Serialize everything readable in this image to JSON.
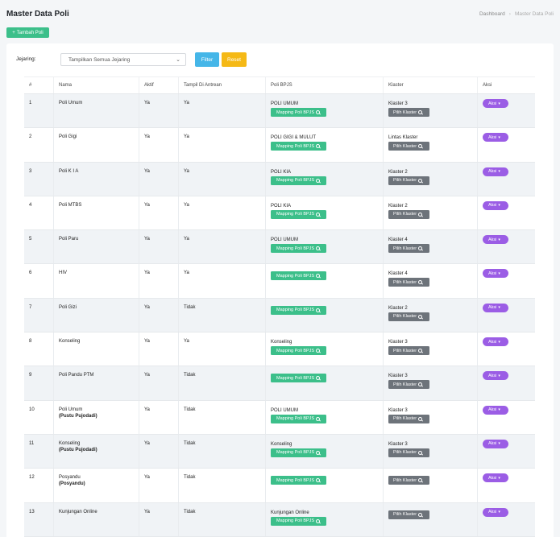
{
  "header": {
    "title": "Master Data Poli",
    "breadcrumb": [
      "Dashboard",
      "Master Data Poli"
    ]
  },
  "actions": {
    "add_label": "Tambah Poli"
  },
  "filter": {
    "label": "Jejaring:",
    "selected": "Tampilkan Semua Jejaring",
    "filter_label": "Filter",
    "reset_label": "Reset"
  },
  "table": {
    "columns": [
      "#",
      "Nama",
      "Aktif",
      "Tampil Di Antrean",
      "Poli BPJS",
      "Klaster",
      "Aksi"
    ],
    "map_label": "Mapping Poli BPJS",
    "klaster_label": "Pilih Klaster",
    "aksi_label": "Aksi",
    "rows": [
      {
        "no": "1",
        "nama": "Poli Umum",
        "sub": "",
        "aktif": "Ya",
        "tampil": "Ya",
        "bpjs": "POLI UMUM",
        "klaster": "Klaster 3"
      },
      {
        "no": "2",
        "nama": "Poli Gigi",
        "sub": "",
        "aktif": "Ya",
        "tampil": "Ya",
        "bpjs": "POLI GIGI & MULUT",
        "klaster": "Lintas Klaster"
      },
      {
        "no": "3",
        "nama": "Poli K I A",
        "sub": "",
        "aktif": "Ya",
        "tampil": "Ya",
        "bpjs": "POLI KIA",
        "klaster": "Klaster 2"
      },
      {
        "no": "4",
        "nama": "Poli MTBS",
        "sub": "",
        "aktif": "Ya",
        "tampil": "Ya",
        "bpjs": "POLI KIA",
        "klaster": "Klaster 2"
      },
      {
        "no": "5",
        "nama": "Poli Paru",
        "sub": "",
        "aktif": "Ya",
        "tampil": "Ya",
        "bpjs": "POLI UMUM",
        "klaster": "Klaster 4"
      },
      {
        "no": "6",
        "nama": "HIV",
        "sub": "",
        "aktif": "Ya",
        "tampil": "Ya",
        "bpjs": "",
        "klaster": "Klaster 4"
      },
      {
        "no": "7",
        "nama": "Poli Gizi",
        "sub": "",
        "aktif": "Ya",
        "tampil": "Tidak",
        "bpjs": "",
        "klaster": "Klaster 2"
      },
      {
        "no": "8",
        "nama": "Konseling",
        "sub": "",
        "aktif": "Ya",
        "tampil": "Ya",
        "bpjs": "Konseling",
        "klaster": "Klaster 3"
      },
      {
        "no": "9",
        "nama": "Poli Pandu PTM",
        "sub": "",
        "aktif": "Ya",
        "tampil": "Tidak",
        "bpjs": "",
        "klaster": "Klaster 3"
      },
      {
        "no": "10",
        "nama": "Poli Umum",
        "sub": "(Pustu Pujodadi)",
        "aktif": "Ya",
        "tampil": "Tidak",
        "bpjs": "POLI UMUM",
        "klaster": "Klaster 3"
      },
      {
        "no": "11",
        "nama": "Konseling",
        "sub": "(Pustu Pujodadi)",
        "aktif": "Ya",
        "tampil": "Tidak",
        "bpjs": "Konseling",
        "klaster": "Klaster 3"
      },
      {
        "no": "12",
        "nama": "Posyandu",
        "sub": "(Posyandu)",
        "aktif": "Ya",
        "tampil": "Tidak",
        "bpjs": "",
        "klaster": ""
      },
      {
        "no": "13",
        "nama": "Kunjungan Online",
        "sub": "",
        "aktif": "Ya",
        "tampil": "Tidak",
        "bpjs": "Kunjungan Online",
        "klaster": ""
      }
    ]
  },
  "colors": {
    "green": "#3cbf8a",
    "gray": "#6d737a",
    "purple": "#9b5de5",
    "blue": "#45b6e8",
    "yellow": "#f5b916"
  }
}
